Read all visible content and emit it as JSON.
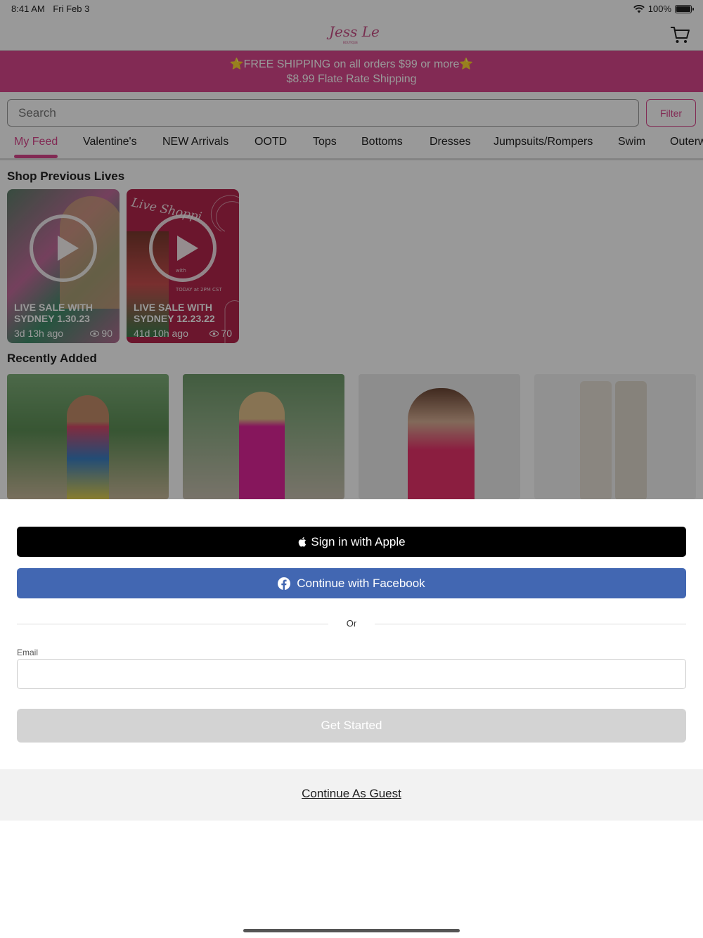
{
  "status_bar": {
    "time": "8:41 AM",
    "date": "Fri Feb 3",
    "battery": "100%"
  },
  "colors": {
    "brand_pink": "#d9468c",
    "promo_bg": "#d9468c",
    "facebook_blue": "#4267b2",
    "apple_black": "#000000",
    "disabled_gray": "#d3d3d3"
  },
  "header": {
    "logo_text": "Jess Lea",
    "logo_sub": "BOUTIQUE"
  },
  "promo": {
    "line1": "⭐FREE SHIPPING on all orders $99 or more⭐",
    "line2": "$8.99 Flate Rate Shipping"
  },
  "search": {
    "placeholder": "Search",
    "filter_label": "Filter"
  },
  "tabs": [
    "My Feed",
    "Valentine's",
    "NEW Arrivals",
    "OOTD",
    "Tops",
    "Bottoms",
    "Dresses",
    "Jumpsuits/Rompers",
    "Swim",
    "Outerw"
  ],
  "sections": {
    "previous_lives": "Shop Previous Lives",
    "recently_added": "Recently Added"
  },
  "lives": [
    {
      "title": "LIVE SALE WITH SYDNEY 1.30.23",
      "time_ago": "3d 13h ago",
      "views": "90"
    },
    {
      "title": "LIVE SALE WITH SYDNEY 12.23.22",
      "time_ago": "41d 10h ago",
      "views": "70",
      "overlay_text": "Live Shoppi",
      "small_text": "with",
      "today_text": "TODAY at 2PM CST"
    }
  ],
  "sheet": {
    "apple_label": "Sign in with Apple",
    "facebook_label": "Continue with Facebook",
    "or_label": "Or",
    "email_label": "Email",
    "email_value": "",
    "get_started_label": "Get Started",
    "guest_label": "Continue As Guest"
  }
}
